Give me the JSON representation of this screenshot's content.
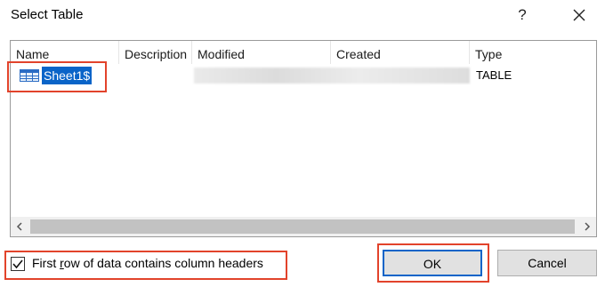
{
  "window": {
    "title": "Select Table",
    "help_label": "?"
  },
  "table": {
    "columns": [
      "Name",
      "Description",
      "Modified",
      "Created",
      "Type"
    ],
    "rows": [
      {
        "name": "Sheet1$",
        "description": "",
        "modified": "",
        "created": "",
        "type": "TABLE"
      }
    ],
    "icon": "table-icon",
    "selection_color": "#0a64c8"
  },
  "options": {
    "first_row_headers_label_pre": "First ",
    "first_row_headers_label_underlined": "r",
    "first_row_headers_label_post": "ow of data contains column headers",
    "first_row_headers_checked": true
  },
  "buttons": {
    "ok": "OK",
    "cancel": "Cancel"
  },
  "annotation": {
    "highlight_color": "#e2432b"
  }
}
